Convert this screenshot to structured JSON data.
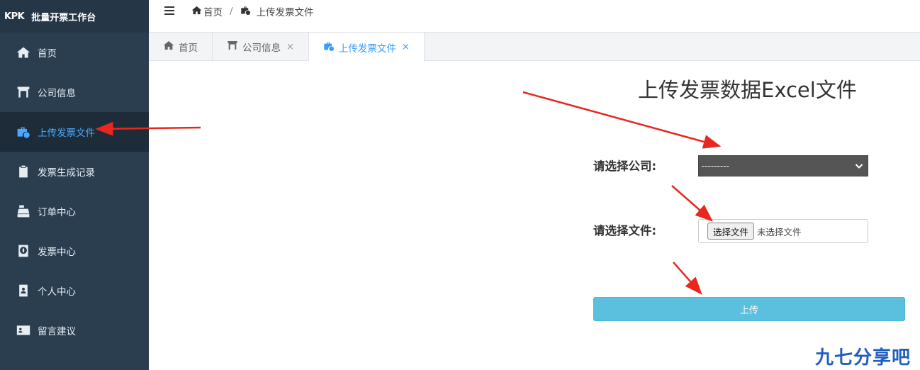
{
  "app": {
    "logo": "KPK",
    "title": "批量开票工作台"
  },
  "sidebar": {
    "items": [
      {
        "label": "首页",
        "icon": "home-icon"
      },
      {
        "label": "公司信息",
        "icon": "building-icon"
      },
      {
        "label": "上传发票文件",
        "icon": "briefcase-clock-icon",
        "active": true
      },
      {
        "label": "发票生成记录",
        "icon": "clipboard-icon"
      },
      {
        "label": "订单中心",
        "icon": "cash-register-icon"
      },
      {
        "label": "发票中心",
        "icon": "globe-book-icon"
      },
      {
        "label": "个人中心",
        "icon": "id-badge-icon"
      },
      {
        "label": "留言建议",
        "icon": "id-card-icon"
      }
    ]
  },
  "breadcrumb": {
    "home": "首页",
    "separator": "/",
    "current": "上传发票文件"
  },
  "tabs": [
    {
      "label": "首页",
      "closable": false
    },
    {
      "label": "公司信息",
      "closable": true,
      "close": "×"
    },
    {
      "label": "上传发票文件",
      "closable": true,
      "close": "×",
      "active": true
    }
  ],
  "form": {
    "heading": "上传发票数据Excel文件",
    "company_label": "请选择公司:",
    "company_selected": "---------",
    "file_label": "请选择文件:",
    "file_button": "选择文件",
    "file_status": "未选择文件",
    "upload_button": "上传"
  },
  "watermark": "九七分享吧",
  "colors": {
    "sidebar": "#2b3e50",
    "accent": "#3a9bff",
    "upload": "#5bc0de",
    "arrow": "#e8281e"
  }
}
